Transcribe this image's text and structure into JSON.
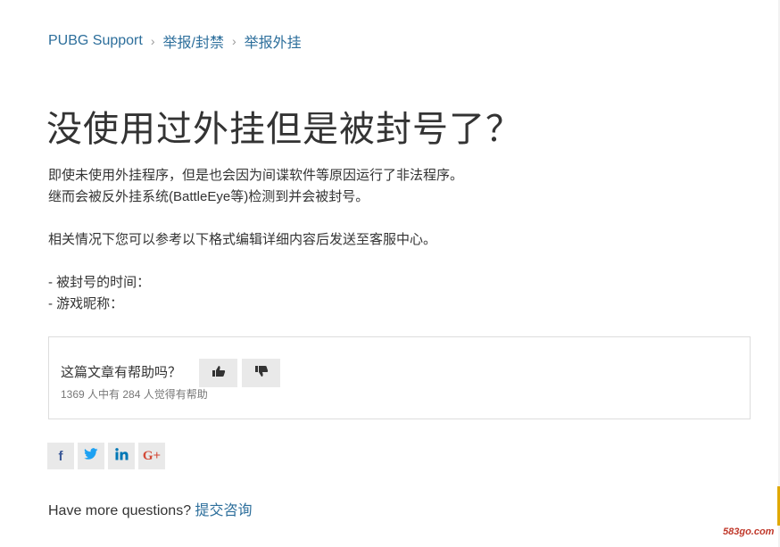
{
  "breadcrumb": {
    "items": [
      "PUBG Support",
      "举报/封禁",
      "举报外挂"
    ],
    "separator": "›"
  },
  "article": {
    "title": "没使用过外挂但是被封号了？",
    "paragraphs": [
      "即使未使用外挂程序，但是也会因为间谍软件等原因运行了非法程序。",
      "继而会被反外挂系统(BattleEye等)检测到并会被封号。",
      "相关情况下您可以参考以下格式编辑详细内容后发送至客服中心。",
      "- 被封号的时间：",
      "- 游戏昵称："
    ]
  },
  "vote": {
    "question": "这篇文章有帮助吗？",
    "count_text": "1369 人中有 284 人觉得有帮助",
    "up_icon": "thumbs-up-icon",
    "down_icon": "thumbs-down-icon"
  },
  "share": {
    "facebook": "f",
    "google": "G+",
    "colors": {
      "facebook": "#3b5998",
      "twitter": "#1da1f2",
      "linkedin": "#0077b5",
      "google": "#d34836"
    }
  },
  "footer": {
    "question": "Have more questions?",
    "link": "提交咨询"
  },
  "watermark": "583go.com",
  "colors": {
    "link": "#2c6e9b",
    "text": "#333333",
    "muted": "#777777"
  }
}
